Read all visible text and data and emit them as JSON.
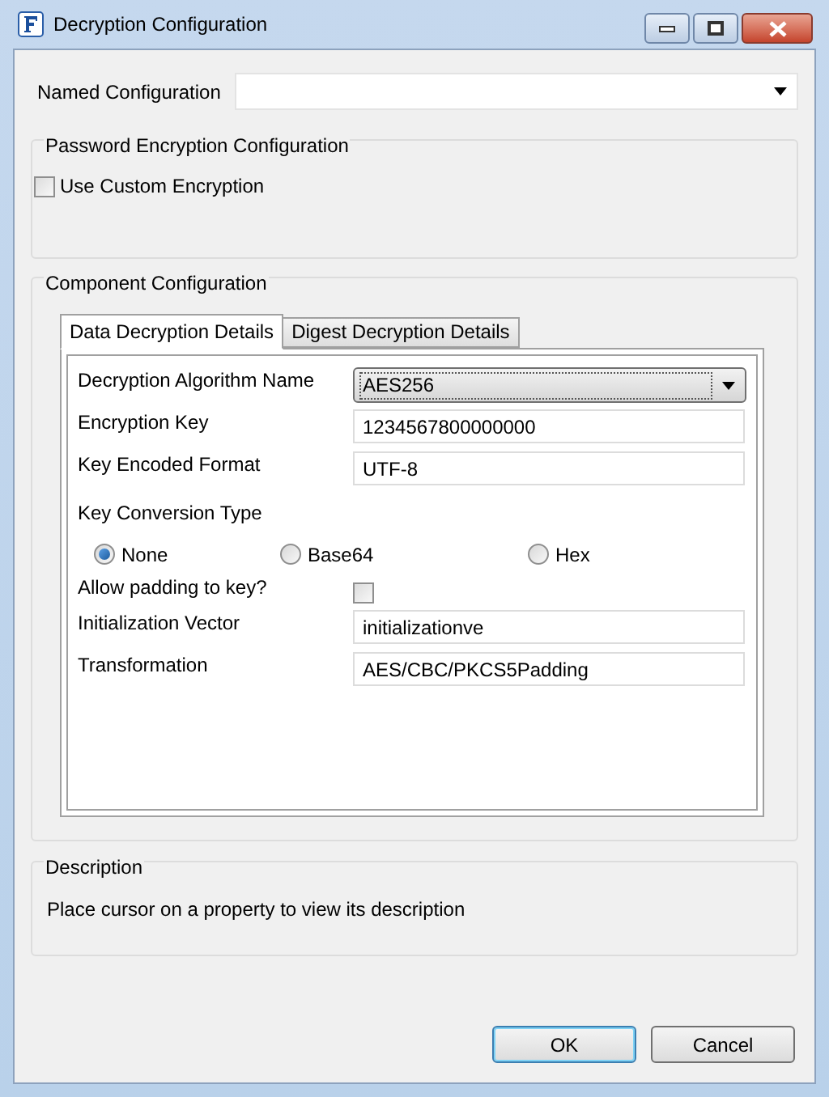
{
  "window": {
    "title": "Decryption Configuration"
  },
  "named_configuration": {
    "label": "Named Configuration"
  },
  "password_group": {
    "title": "Password Encryption Configuration",
    "option": {
      "label": "Use Custom Encryption",
      "checked": false
    }
  },
  "component_group": {
    "title": "Component Configuration",
    "tabs": [
      {
        "label": "Data Decryption Details",
        "selected": true
      },
      {
        "label": "Digest Decryption Details",
        "selected": false
      }
    ],
    "fields": [
      {
        "kind": "dropdown",
        "label": "Decryption Algorithm Name",
        "value": "AES256"
      },
      {
        "kind": "text",
        "label": "Encryption Key",
        "value": "1234567800000000"
      },
      {
        "kind": "text",
        "label": "Key Encoded Format",
        "value": "UTF-8"
      },
      {
        "kind": "radio",
        "label": "Key Conversion Type",
        "options": [
          {
            "label": "None",
            "selected": true
          },
          {
            "label": "Base64",
            "selected": false
          },
          {
            "label": "Hex",
            "selected": false
          }
        ]
      },
      {
        "kind": "checkbox",
        "label": "Allow padding to key?",
        "checked": false
      },
      {
        "kind": "text",
        "label": "Initialization Vector",
        "value": "initializationve"
      },
      {
        "kind": "text",
        "label": "Transformation",
        "value": "AES/CBC/PKCS5Padding"
      }
    ]
  },
  "description": {
    "title": "Description",
    "text": "Place cursor on a property to view its description"
  },
  "buttons": [
    {
      "label": "OK",
      "focused": true
    },
    {
      "label": "Cancel",
      "focused": false
    }
  ]
}
